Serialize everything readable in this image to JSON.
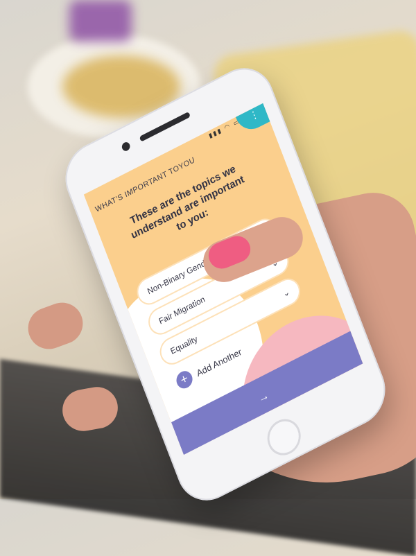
{
  "app": {
    "page_title": "WHAT'S IMPORTANT TOYOU",
    "menu_icon": "more-dots-icon",
    "heading": "These are the topics we understand are important to you:"
  },
  "topics": [
    {
      "label": "Non-Binary Gender"
    },
    {
      "label": "Fair Migration"
    },
    {
      "label": "Equality"
    }
  ],
  "add_another": "Add Another",
  "next_icon": "arrow-right-icon",
  "colors": {
    "screen_bg": "#fbcf8d",
    "accent_purple": "#7b7bc6",
    "accent_teal": "#2fb8c7",
    "accent_pink": "#f6b8c0"
  }
}
